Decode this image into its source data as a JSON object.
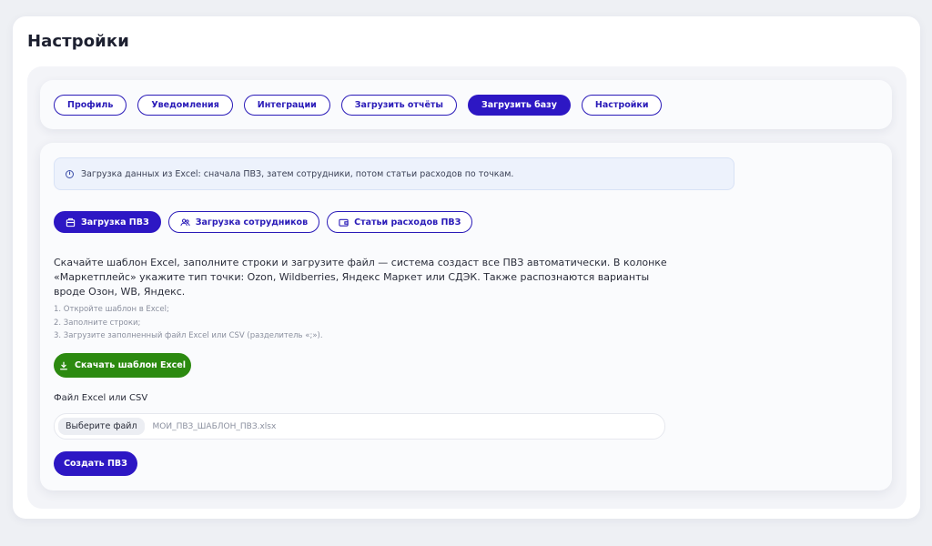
{
  "page": {
    "title": "Настройки"
  },
  "tabs": [
    {
      "label": "Профиль",
      "active": false
    },
    {
      "label": "Уведомления",
      "active": false
    },
    {
      "label": "Интеграции",
      "active": false
    },
    {
      "label": "Загрузить отчёты",
      "active": false
    },
    {
      "label": "Загрузить базу",
      "active": true
    },
    {
      "label": "Настройки",
      "active": false
    }
  ],
  "info": {
    "text": "Загрузка данных из Excel: сначала ПВЗ, затем сотрудники, потом статьи расходов по точкам."
  },
  "subtabs": [
    {
      "label": "Загрузка ПВЗ",
      "icon": "building-icon",
      "active": true
    },
    {
      "label": "Загрузка сотрудников",
      "icon": "users-icon",
      "active": false
    },
    {
      "label": "Статьи расходов ПВЗ",
      "icon": "wallet-icon",
      "active": false
    }
  ],
  "description": "Скачайте шаблон Excel, заполните строки и загрузите файл — система создаст все ПВЗ автоматически. В колонке «Маркетплейс» укажите тип точки: Ozon, Wildberries, Яндекс Маркет или СДЭК. Также распознаются варианты вроде Озон, WB, Яндекс.",
  "steps": [
    "1. Откройте шаблон в Excel;",
    "2. Заполните строки;",
    "3. Загрузите заполненный файл Excel или CSV (разделитель «;»)."
  ],
  "download_button": {
    "label": "Скачать шаблон Excel",
    "icon": "download-icon"
  },
  "file": {
    "label": "Файл Excel или CSV",
    "choose_label": "Выберите файл",
    "file_name": "МОИ_ПВЗ_ШАБЛОН_ПВЗ.xlsx"
  },
  "create_button": {
    "label": "Создать ПВЗ"
  },
  "colors": {
    "accent": "#2d17c4",
    "success": "#2c8a10",
    "info_bg": "#edf2fc"
  }
}
